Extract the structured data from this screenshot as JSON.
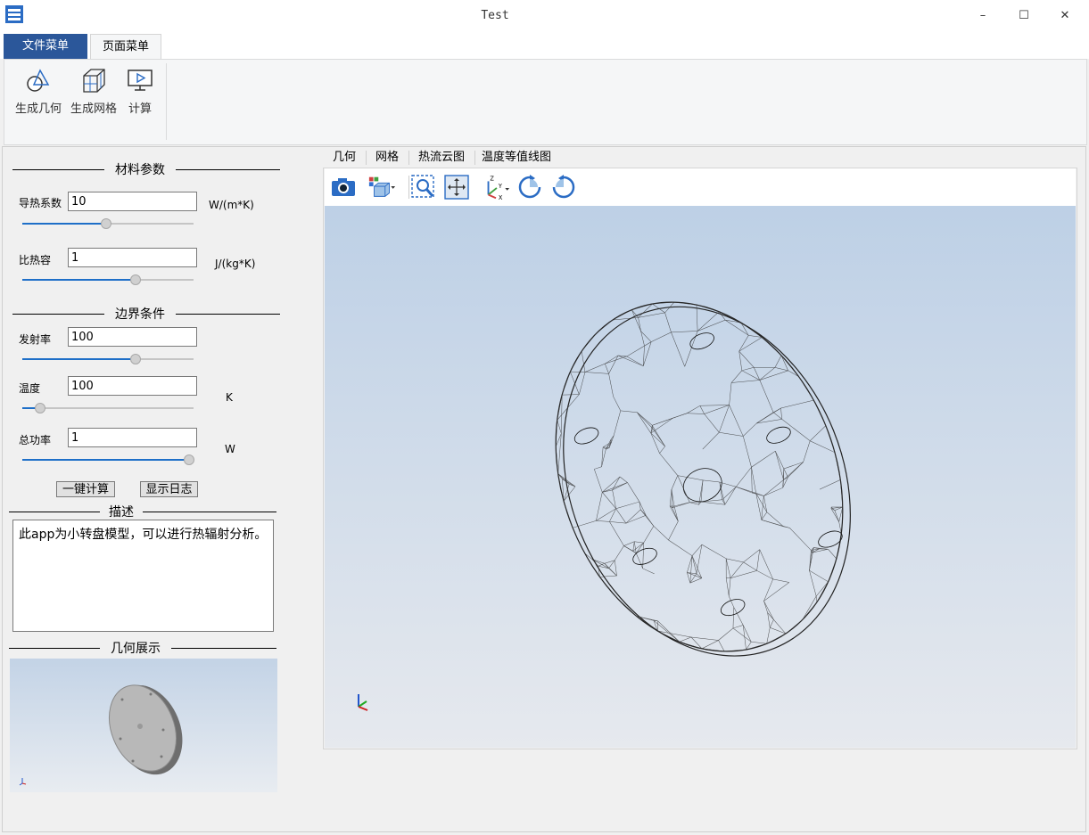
{
  "window": {
    "title": "Test",
    "minimize": "–",
    "maximize": "☐",
    "close": "✕"
  },
  "ribbon": {
    "tabs": [
      "文件菜单",
      "页面菜单"
    ],
    "buttons": [
      "生成几何",
      "生成网格",
      "计算"
    ]
  },
  "panel": {
    "material_title": "材料参数",
    "thermal_conductivity": {
      "label": "导热系数",
      "value": "10",
      "unit": "W/(m*K)",
      "slider": 0.5
    },
    "specific_heat": {
      "label": "比热容",
      "value": "1",
      "unit": "J/(kg*K)",
      "slider": 0.68
    },
    "boundary_title": "边界条件",
    "emissivity": {
      "label": "发射率",
      "value": "100",
      "unit": "",
      "slider": 0.68
    },
    "temperature": {
      "label": "温度",
      "value": "100",
      "unit": "K",
      "slider": 0.1
    },
    "total_power": {
      "label": "总功率",
      "value": "1",
      "unit": "W",
      "slider": 1.0
    },
    "calc_button": "一键计算",
    "log_button": "显示日志",
    "desc_title": "描述",
    "description": "此app为小转盘模型，可以进行热辐射分析。",
    "geometry_title": "几何展示"
  },
  "viewer": {
    "tabs": [
      "几何",
      "网格",
      "热流云图",
      "温度等值线图"
    ],
    "active_tab": "几何",
    "toolbar_icons": [
      "camera-icon",
      "view-cube-icon",
      "zoom-box-icon",
      "fit-view-icon",
      "axes-icon",
      "rotate-cw-icon",
      "rotate-ccw-icon"
    ]
  },
  "colors": {
    "accent": "#2b579a",
    "slider": "#1e6fc8",
    "viewport_top": "#bdd0e6",
    "viewport_bottom": "#e6e9ee"
  }
}
